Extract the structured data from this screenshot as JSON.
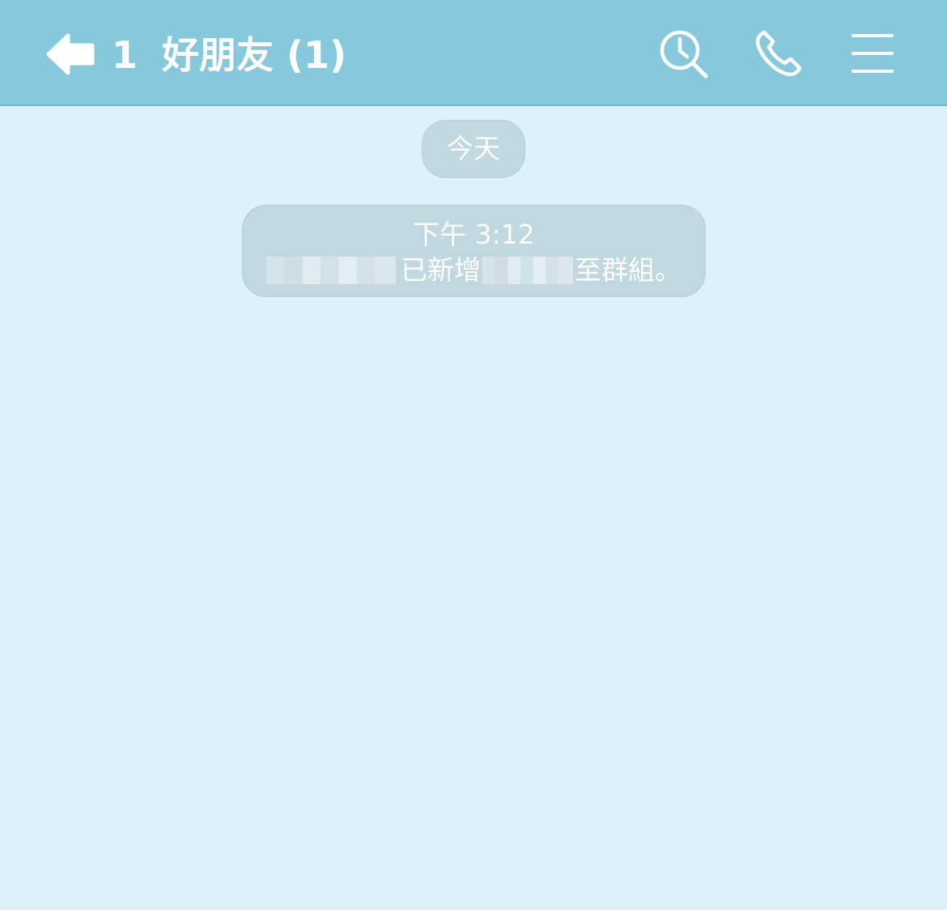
{
  "colors": {
    "header_bg": "#86c8dc",
    "chat_bg": "#dcf2f8",
    "pill_bg": "#c0d8df"
  },
  "header": {
    "back_icon": "back-arrow-icon",
    "unread_count": "1",
    "title": "好朋友 (1)",
    "icons": [
      "search-history-icon",
      "phone-icon",
      "menu-icon"
    ]
  },
  "chat": {
    "date_separator": "今天",
    "system_message": {
      "time": "下午 3:12",
      "added_text": "已新增",
      "to_group_text": "至群組。"
    }
  }
}
